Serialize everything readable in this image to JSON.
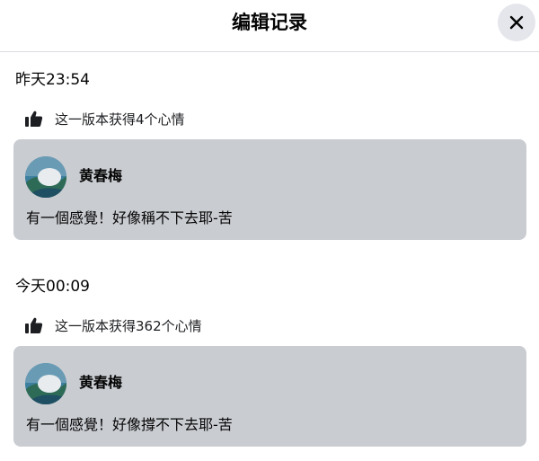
{
  "header": {
    "title": "编辑记录",
    "close_icon": "close-icon"
  },
  "colors": {
    "card_background": "#c9ccd1",
    "close_button_background": "#e4e6eb",
    "divider": "#dadde1"
  },
  "versions": [
    {
      "timestamp": "昨天23:54",
      "reactions_icon": "thumbs-up-icon",
      "reactions_text": "这一版本获得4个心情",
      "author": "黄春梅",
      "text": "有一個感覺！好像稱不下去耶-苦"
    },
    {
      "timestamp": "今天00:09",
      "reactions_icon": "thumbs-up-icon",
      "reactions_text": "这一版本获得362个心情",
      "author": "黄春梅",
      "text": "有一個感覺！好像撐不下去耶-苦"
    }
  ]
}
